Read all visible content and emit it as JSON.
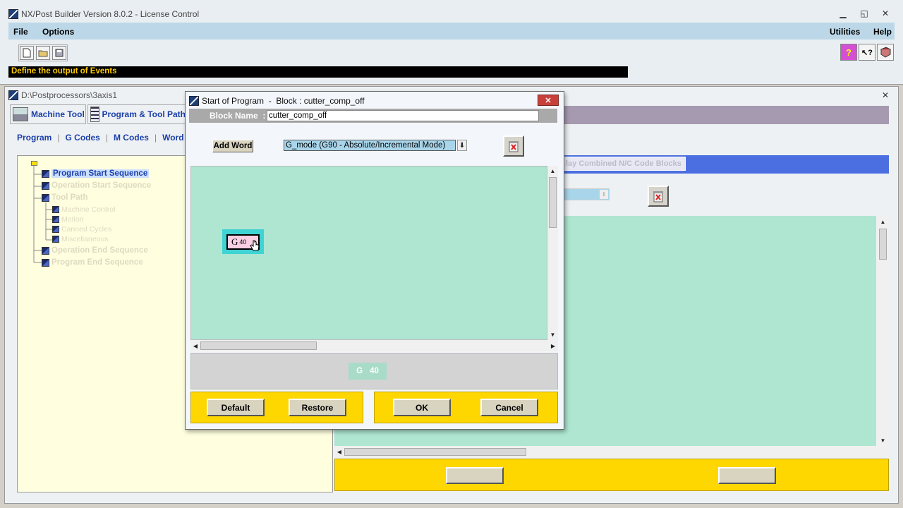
{
  "app": {
    "title": "NX/Post Builder Version 8.0.2 - License Control",
    "menu": {
      "file": "File",
      "options": "Options",
      "utilities": "Utilities",
      "help": "Help"
    },
    "status": "Define the output of Events"
  },
  "child_window": {
    "title": "D:\\Postprocessors\\3axis1",
    "main_tabs": [
      "Machine Tool",
      "Program & Tool Path"
    ],
    "sub_tabs": [
      "Program",
      "G Codes",
      "M Codes",
      "Word Su"
    ],
    "tree": {
      "items": [
        {
          "label": "Program Start Sequence"
        },
        {
          "label": "Operation Start Sequence"
        },
        {
          "label": "Tool Path"
        },
        {
          "label": "Machine Control"
        },
        {
          "label": "Motion"
        },
        {
          "label": "Canned Cycles"
        },
        {
          "label": "Miscellaneous"
        },
        {
          "label": "Operation End Sequence"
        },
        {
          "label": "Program End Sequence"
        }
      ]
    },
    "combined_label": "lay Combined N/C Code Blocks"
  },
  "dialog": {
    "title": "Start of Program  -  Block : cutter_comp_off",
    "block_name_label": "Block Name  :",
    "block_name_value": "cutter_comp_off",
    "add_word_label": "Add Word",
    "word_select_value": "G_mode (G90 - Absolute/Incremental Mode)",
    "word_chip": {
      "letter": "G",
      "value": "40"
    },
    "preview": {
      "letter": "G",
      "value": "40"
    },
    "buttons": {
      "default": "Default",
      "restore": "Restore",
      "ok": "OK",
      "cancel": "Cancel"
    }
  },
  "colors": {
    "menubar": "#bcd8e8",
    "canvas": "#aee6d2",
    "yellow": "#ffd700",
    "blue_bar": "#4b6fe0",
    "tree_bg": "#ffffe0",
    "selected": "#cce0ff"
  }
}
